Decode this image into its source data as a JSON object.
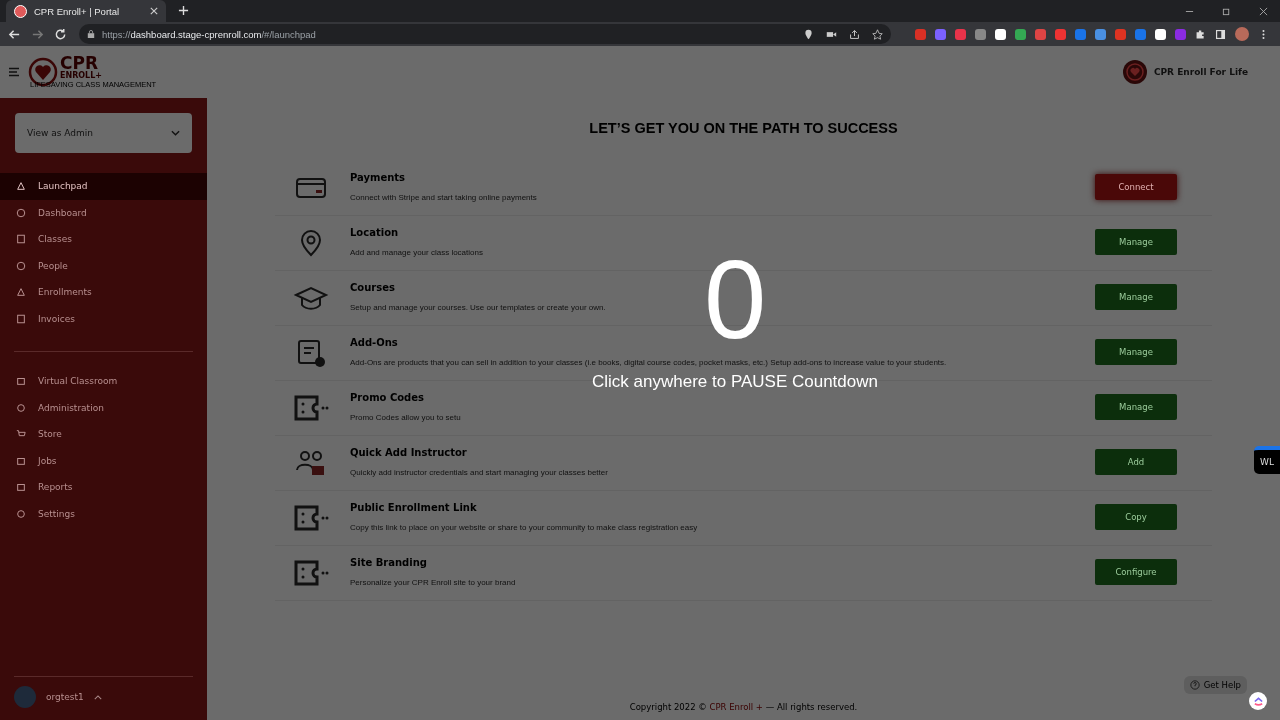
{
  "browser": {
    "tab_title": "CPR Enroll+ | Portal",
    "url_host": "dashboard.stage-cprenroll.com",
    "url_scheme": "https://",
    "url_path": "/#/launchpad"
  },
  "header": {
    "logo_top": "CPR",
    "logo_mid": "ENROLL+",
    "logo_sub": "LIFESAVING CLASS MANAGEMENT",
    "org_name": "CPR Enroll For Life"
  },
  "sidebar": {
    "role_select": "View as Admin",
    "menu": [
      {
        "label": "Launchpad",
        "selected": true
      },
      {
        "label": "Dashboard",
        "selected": false
      },
      {
        "label": "Classes",
        "selected": false
      },
      {
        "label": "People",
        "selected": false
      },
      {
        "label": "Enrollments",
        "selected": false
      },
      {
        "label": "Invoices",
        "selected": false
      }
    ],
    "menu_2": [
      {
        "label": "Virtual Classroom",
        "selected": false
      },
      {
        "label": "Administration",
        "selected": false
      },
      {
        "label": "Store",
        "selected": false
      },
      {
        "label": "Jobs",
        "selected": false
      },
      {
        "label": "Reports",
        "selected": false
      },
      {
        "label": "Settings",
        "selected": false
      }
    ],
    "user": "orgtest1"
  },
  "heading": "LET’S GET YOU ON THE PATH TO SUCCESS",
  "tasks": [
    {
      "title": "Payments",
      "description": "Connect with Stripe and start taking online payments",
      "button": "Connect",
      "kind": "primary"
    },
    {
      "title": "Location",
      "description": "Add and manage your class locations",
      "button": "Manage",
      "kind": "done"
    },
    {
      "title": "Courses",
      "description": "Setup and manage your courses. Use our templates or create your own.",
      "button": "Manage",
      "kind": "done"
    },
    {
      "title": "Add-Ons",
      "description": "Add-Ons are products that you can sell in addition to your classes (i.e books, digital course codes, pocket masks, etc.) Setup add-ons to increase value to your students.",
      "button": "Manage",
      "kind": "done"
    },
    {
      "title": "Promo Codes",
      "description": "Promo Codes allow you to setu",
      "button": "Manage",
      "kind": "done"
    },
    {
      "title": "Quick Add Instructor",
      "description": "Quickly add instructor credentials and start managing your classes better",
      "button": "Add",
      "kind": "done"
    },
    {
      "title": "Public Enrollment Link",
      "description": "Copy this link to place on your website or share to your community to make class registration easy",
      "button": "Copy",
      "kind": "done"
    },
    {
      "title": "Site Branding",
      "description": "Personalize your CPR Enroll site to your brand",
      "button": "Configure",
      "kind": "done"
    }
  ],
  "countdown": {
    "number": "0",
    "hint": "Click anywhere to PAUSE Countdown"
  },
  "footer": {
    "before": "Copyright 2022 ©",
    "link": "CPR Enroll +",
    "after": "— All rights reserved."
  },
  "widget": {
    "label": "WL"
  },
  "help_button": "Get Help"
}
